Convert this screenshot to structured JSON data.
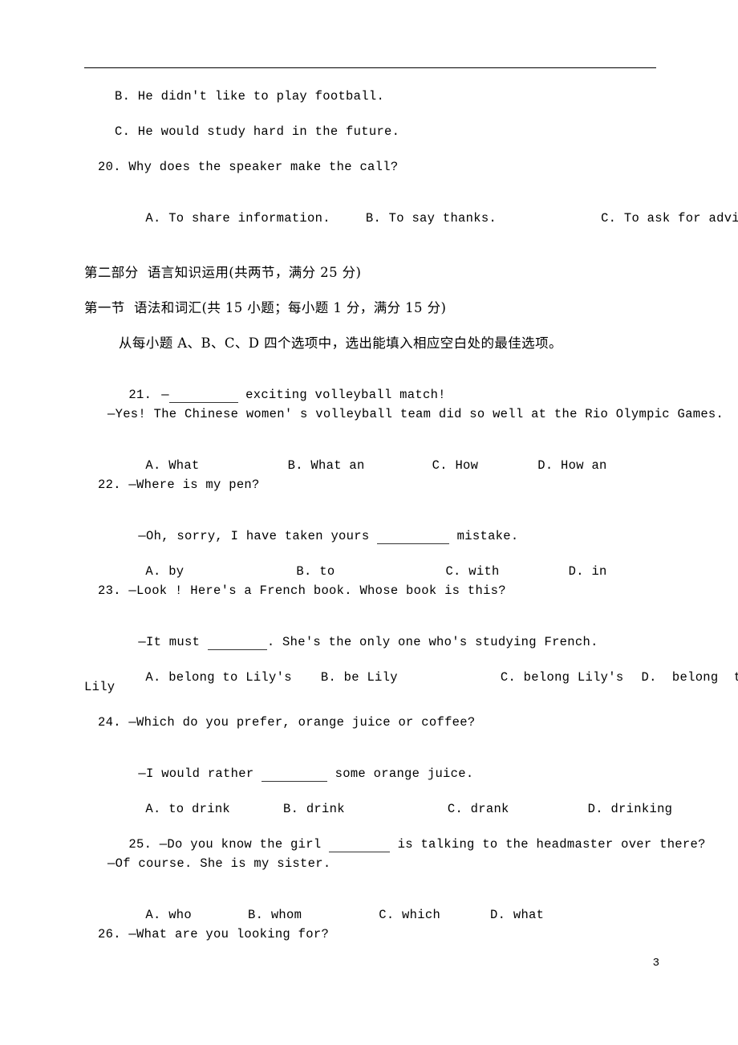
{
  "document": {
    "page_number": "3",
    "header_rule": true
  },
  "listening_tail": {
    "q19_options": [
      "B. He didn't like to play football.",
      "C. He would study hard in the future."
    ],
    "q20_stem": "20. Why does the speaker make the call?",
    "q20_options": [
      "A. To share information.",
      "B. To say thanks.",
      "C. To ask for advice."
    ]
  },
  "part_two": {
    "part_heading": "第二部分  语言知识运用(共两节，满分 25 分)",
    "section_heading": "第一节  语法和词汇(共 15 小题；每小题 1 分，满分 15 分)",
    "instruction": "从每小题 A、B、C、D 四个选项中，选出能填入相应空白处的最佳选项。"
  },
  "questions": [
    {
      "number": "21.",
      "stem_prefix": "—",
      "stem_suffix": " exciting volleyball match!",
      "reply": "—Yes! The Chinese women' s volleyball team did so well at the Rio Olympic Games.",
      "options": [
        "A. What",
        "B. What an",
        "C. How",
        "D. How an"
      ]
    },
    {
      "number": "22.",
      "stem": "22. —Where is my pen?",
      "reply_prefix": "—Oh, sorry, I have taken yours ",
      "reply_suffix": " mistake.",
      "options": [
        "A. by",
        "B. to",
        "C. with",
        "D. in"
      ]
    },
    {
      "number": "23.",
      "stem": "23. —Look ! Here's a French book. Whose book is this?",
      "reply_prefix": "—It must ",
      "reply_suffix": ". She's the only one who's studying French.",
      "options": [
        "A. belong to Lily's",
        "B. be Lily",
        "C. belong Lily's",
        "D.  belong  to"
      ],
      "options_wrap": "Lily"
    },
    {
      "number": "24.",
      "stem": "24. —Which do you prefer, orange juice or coffee?",
      "reply_prefix": "—I would rather ",
      "reply_suffix": " some orange juice.",
      "options": [
        "A. to drink",
        "B. drink",
        "C. drank",
        "D. drinking"
      ]
    },
    {
      "number": "25.",
      "stem_prefix": "25. —Do you know the girl ",
      "stem_suffix": " is talking to the headmaster over there?",
      "reply": "—Of course. She is my sister.",
      "options": [
        "A. who",
        "B. whom",
        "C. which",
        "D. what"
      ]
    },
    {
      "number": "26.",
      "stem": "26. —What are you looking for?"
    }
  ]
}
